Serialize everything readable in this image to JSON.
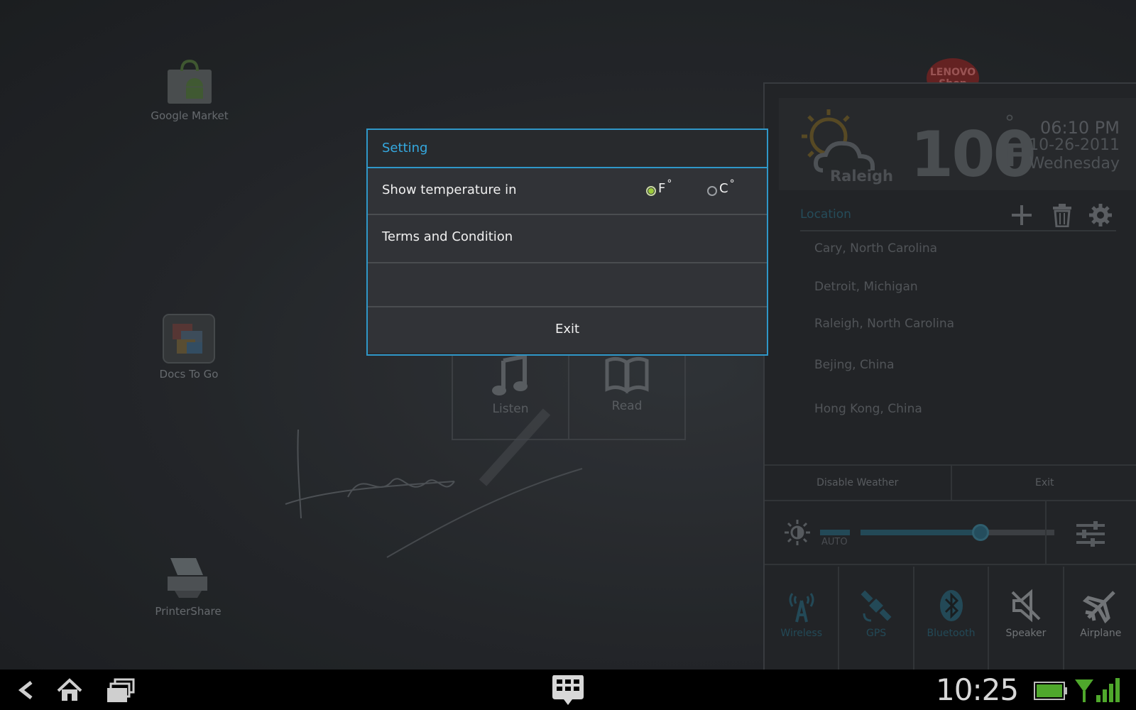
{
  "desktop": {
    "apps": [
      {
        "label": "Google Market"
      },
      {
        "label": "Docs To Go"
      },
      {
        "label": "PrinterShare"
      }
    ],
    "launcher": {
      "listen_label": "Listen",
      "read_label": "Read"
    }
  },
  "weather": {
    "temperature": "100",
    "degree_symbol": "°",
    "unit": "F",
    "city": "Raleigh",
    "time": "06:10 PM",
    "date": "10-26-2011",
    "weekday": "Wednesday",
    "location_title": "Location",
    "locations": [
      "Cary, North Carolina",
      "Detroit, Michigan",
      "Raleigh, North Carolina",
      "Bejing, China",
      "Hong Kong, China"
    ],
    "disable_label": "Disable Weather",
    "exit_label": "Exit",
    "brightness_auto_label": "AUTO",
    "brightness_level": 0.62,
    "toggles": [
      {
        "label": "Wireless",
        "icon": "wireless-icon",
        "active": true
      },
      {
        "label": "GPS",
        "icon": "gps-icon",
        "active": true
      },
      {
        "label": "Bluetooth",
        "icon": "bluetooth-icon",
        "active": true
      },
      {
        "label": "Speaker",
        "icon": "speaker-muted-icon",
        "active": false
      },
      {
        "label": "Airplane",
        "icon": "airplane-icon",
        "active": false
      }
    ],
    "lenovo_logo_text": "LENOVO Shop"
  },
  "dialog": {
    "title": "Setting",
    "temp_label": "Show temperature in",
    "option_f": "F",
    "option_c": "C",
    "option_sup": "°",
    "selected": "F",
    "terms_label": "Terms and Condition",
    "exit_label": "Exit"
  },
  "system_bar": {
    "clock": "10:25"
  },
  "colors": {
    "accent": "#35a9e0",
    "radio_checked": "#9ccb3b",
    "toggle_active": "#2b5a6b",
    "toggle_inactive": "#8a8e92"
  }
}
